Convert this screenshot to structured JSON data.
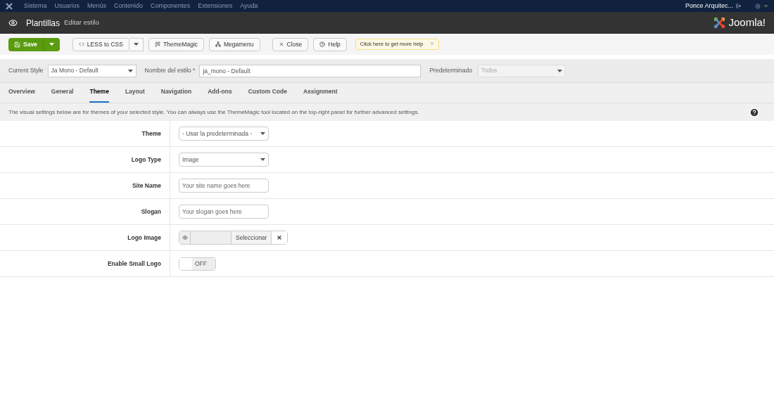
{
  "menu": {
    "items": [
      "Sistema",
      "Usuarios",
      "Menús",
      "Contenido",
      "Componentes",
      "Extensiones",
      "Ayuda"
    ],
    "user": "Ponce Arquitec..."
  },
  "header": {
    "title": "Plantillas",
    "subtitle": "Editar estilo",
    "brand": "Joomla!"
  },
  "toolbar": {
    "save": "Save",
    "buttons": [
      {
        "kind": "split",
        "label": "LESS to CSS"
      },
      {
        "kind": "wand",
        "label": "ThemeMagic"
      },
      {
        "kind": "sitemap",
        "label": "Megamenu"
      },
      {
        "kind": "close",
        "label": "Close"
      },
      {
        "kind": "help",
        "label": "Help"
      }
    ],
    "tip": "Click here to get more help",
    "tip_close": "×"
  },
  "style_bar": {
    "current_label": "Current Style",
    "current_value": "Ja Mono - Default",
    "name_label": "Nombre del estilo *",
    "name_value": "ja_mono - Default",
    "default_label": "Predeterminado",
    "default_value": "Todos"
  },
  "tabs": [
    {
      "label": "Overview",
      "selected": false
    },
    {
      "label": "General",
      "selected": false
    },
    {
      "label": "Theme",
      "selected": true
    },
    {
      "label": "Layout",
      "selected": false
    },
    {
      "label": "Navigation",
      "selected": false
    },
    {
      "label": "Add-ons",
      "selected": false
    },
    {
      "label": "Custom Code",
      "selected": false
    },
    {
      "label": "Assignment",
      "selected": false
    }
  ],
  "info": "The visual settings below are for themes of your selected style. You can always use the ThemeMagic tool located on the top-right panel for further advanced settings.",
  "fields": [
    {
      "label": "Theme",
      "kind": "select",
      "value": "- Usar la predeterminada -"
    },
    {
      "label": "Logo Type",
      "kind": "select",
      "value": "Image"
    },
    {
      "label": "Site Name",
      "kind": "text",
      "placeholder": "Your site name goes here"
    },
    {
      "label": "Slogan",
      "kind": "text",
      "placeholder": "Your slogan goes here"
    },
    {
      "label": "Logo Image",
      "kind": "media",
      "button": "Seleccionar"
    },
    {
      "label": "Enable Small Logo",
      "kind": "toggle",
      "on": false,
      "state": "OFF"
    }
  ]
}
